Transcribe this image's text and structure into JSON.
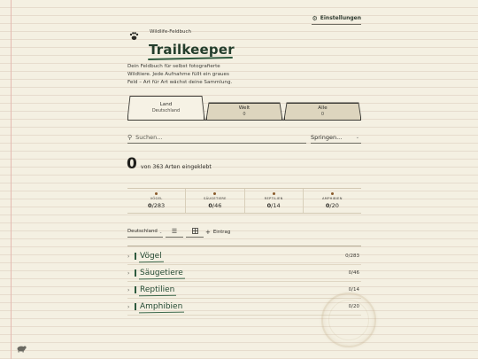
{
  "header": {
    "settings_label": "Einstellungen",
    "settings_icon": "gear-icon",
    "eyebrow": "Wildlife-Feldbuch",
    "title": "Trailkeeper",
    "intro_lines": [
      "Dein Feldbuch für selbst fotografierte",
      "Wildtiere. Jede Aufnahme füllt ein graues",
      "Feld – Art für Art wächst deine Sammlung."
    ]
  },
  "tabs": [
    {
      "label": "Land",
      "sub": "Deutschland",
      "active": true
    },
    {
      "label": "Welt",
      "sub": "0",
      "active": false
    },
    {
      "label": "Alle",
      "sub": "0",
      "active": false
    }
  ],
  "search": {
    "placeholder": "Suchen...",
    "jump_label": "Springen..."
  },
  "counter": {
    "collected": "0",
    "text": "von 363 Arten eingeklebt"
  },
  "stats": [
    {
      "label": "VÖGEL",
      "got": "0",
      "total": "/283",
      "color": "#8a5a2b"
    },
    {
      "label": "SÄUGETIERE",
      "got": "0",
      "total": "/46",
      "color": "#8a5a2b"
    },
    {
      "label": "REPTILIEN",
      "got": "0",
      "total": "/14",
      "color": "#8a5a2b"
    },
    {
      "label": "AMPHIBIEN",
      "got": "0",
      "total": "/20",
      "color": "#8a5a2b"
    }
  ],
  "toolbar": {
    "region": "Deutschland",
    "list_icon": "list-view-icon",
    "grid_icon": "grid-view-icon",
    "entry_label": "Eintrag"
  },
  "categories": [
    {
      "name": "Vögel",
      "count": "0/283"
    },
    {
      "name": "Säugetiere",
      "count": "0/46"
    },
    {
      "name": "Reptilien",
      "count": "0/14"
    },
    {
      "name": "Amphibien",
      "count": "0/20"
    }
  ],
  "colors": {
    "accent_green": "#2e5a3e",
    "paper": "#f4f0e2",
    "margin_line": "#e4b9b0"
  }
}
